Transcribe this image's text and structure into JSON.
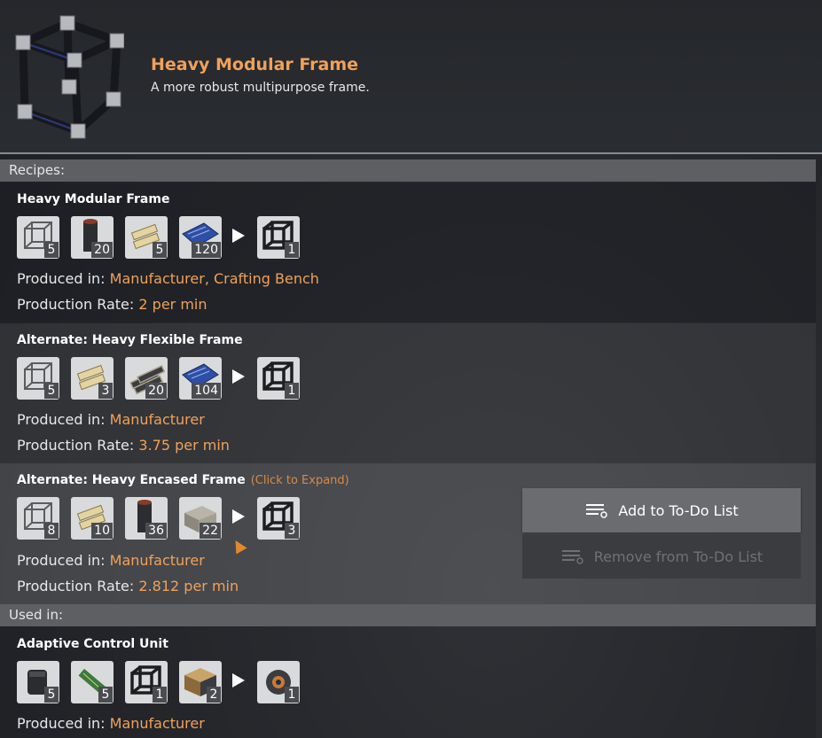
{
  "header": {
    "title": "Heavy Modular Frame",
    "description": "A more robust multipurpose frame."
  },
  "sections": {
    "recipes": "Recipes:",
    "used_in": "Used in:"
  },
  "labels": {
    "produced_in": "Produced in:",
    "production_rate": "Production Rate:"
  },
  "recipes": [
    {
      "title": "Heavy Modular Frame",
      "inputs": [
        {
          "icon": "modular-frame-icon",
          "count": "5"
        },
        {
          "icon": "steel-pipe-icon",
          "count": "20"
        },
        {
          "icon": "encased-beam-icon",
          "count": "5"
        },
        {
          "icon": "screw-icon",
          "count": "120"
        }
      ],
      "output": {
        "icon": "heavy-modular-frame-icon",
        "count": "1"
      },
      "produced_in": "Manufacturer, Crafting Bench",
      "rate": "2 per min"
    },
    {
      "title": "Alternate: Heavy Flexible Frame",
      "inputs": [
        {
          "icon": "modular-frame-icon",
          "count": "5"
        },
        {
          "icon": "encased-beam-icon",
          "count": "3"
        },
        {
          "icon": "rubber-icon",
          "count": "20"
        },
        {
          "icon": "screw-icon",
          "count": "104"
        }
      ],
      "output": {
        "icon": "heavy-modular-frame-icon",
        "count": "1"
      },
      "produced_in": "Manufacturer",
      "rate": "3.75 per min"
    },
    {
      "title": "Alternate: Heavy Encased Frame",
      "expand_hint": "(Click to Expand)",
      "inputs": [
        {
          "icon": "modular-frame-icon",
          "count": "8"
        },
        {
          "icon": "encased-beam-icon",
          "count": "10"
        },
        {
          "icon": "steel-pipe-icon",
          "count": "36"
        },
        {
          "icon": "concrete-icon",
          "count": "22"
        }
      ],
      "output": {
        "icon": "heavy-modular-frame-icon",
        "count": "3"
      },
      "produced_in": "Manufacturer",
      "rate": "2.812 per min"
    }
  ],
  "used_in": [
    {
      "title": "Adaptive Control Unit",
      "inputs": [
        {
          "icon": "automated-wiring-icon",
          "count": "5"
        },
        {
          "icon": "circuit-board-icon",
          "count": "5"
        },
        {
          "icon": "heavy-modular-frame-icon",
          "count": "1"
        },
        {
          "icon": "computer-icon",
          "count": "2"
        }
      ],
      "output": {
        "icon": "adaptive-control-unit-icon",
        "count": "1"
      },
      "produced_in": "Manufacturer"
    }
  ],
  "todo": {
    "add_label": "Add to To-Do List",
    "remove_label": "Remove from To-Do List"
  },
  "colors": {
    "accent": "#f0a15a",
    "section_bar": "#5d5f63",
    "slot_bg": "#d9dadb"
  }
}
